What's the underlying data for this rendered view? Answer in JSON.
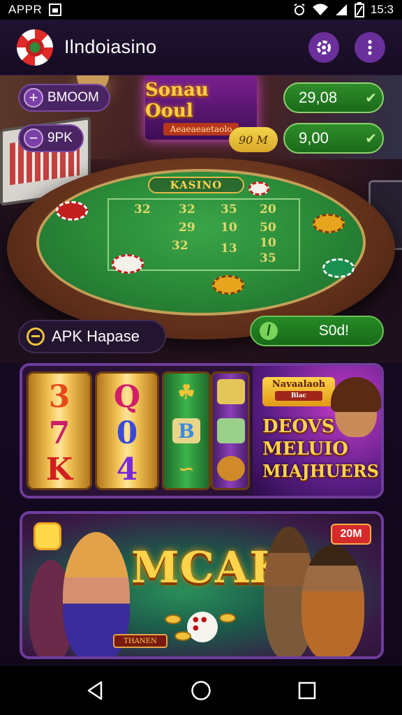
{
  "status_bar": {
    "app_label": "APPR",
    "time": "15:3",
    "icons": [
      "image-notification-icon",
      "alarm-icon",
      "wifi-icon",
      "signal-icon",
      "battery-icon"
    ]
  },
  "header": {
    "title": "Ilndoiasino",
    "settings_icon": "settings-icon",
    "menu_icon": "more-vert-icon",
    "accent_color": "#6a2f9a"
  },
  "table_scene": {
    "neon_sign": {
      "title": "Sonau Ooul",
      "subtitle": "Aeaeaeaetaolo"
    },
    "felt_label": "KASINO",
    "pills_left": [
      {
        "icon": "plus-icon",
        "label": "BMOOM"
      },
      {
        "icon": "minus-icon",
        "label": "9PK"
      }
    ],
    "pills_right": [
      {
        "value": "29,08",
        "icon": "check-icon"
      },
      {
        "value": "9,00",
        "icon": "check-icon"
      }
    ],
    "yellow_tag": "90 M",
    "felt_numbers": [
      "32",
      "32",
      "35",
      "20",
      "29",
      "50",
      "10",
      "32",
      "13",
      "35",
      "10"
    ]
  },
  "apk_bar": {
    "icon": "minus-circle-icon",
    "label": "APK Hapase"
  },
  "green_bar": {
    "icon": "slash-icon",
    "label": "S0d!"
  },
  "slot_card": {
    "reel1": [
      "3",
      "7",
      "K"
    ],
    "reel2": [
      "Q",
      "0",
      "4"
    ],
    "reel3": [
      "☘",
      "B",
      "∽"
    ],
    "promo": {
      "banner_title": "Navaalaoh",
      "banner_sub": "Blac",
      "lines": [
        "DEOVS",
        "MELUIO",
        "MIAJHUERS"
      ]
    }
  },
  "bonus_card": {
    "title": "MCAK",
    "badge": "20M",
    "play_label": "THANEN"
  },
  "nav_bar": {
    "back_icon": "back-triangle-icon",
    "home_icon": "home-circle-icon",
    "recents_icon": "recents-square-icon"
  }
}
